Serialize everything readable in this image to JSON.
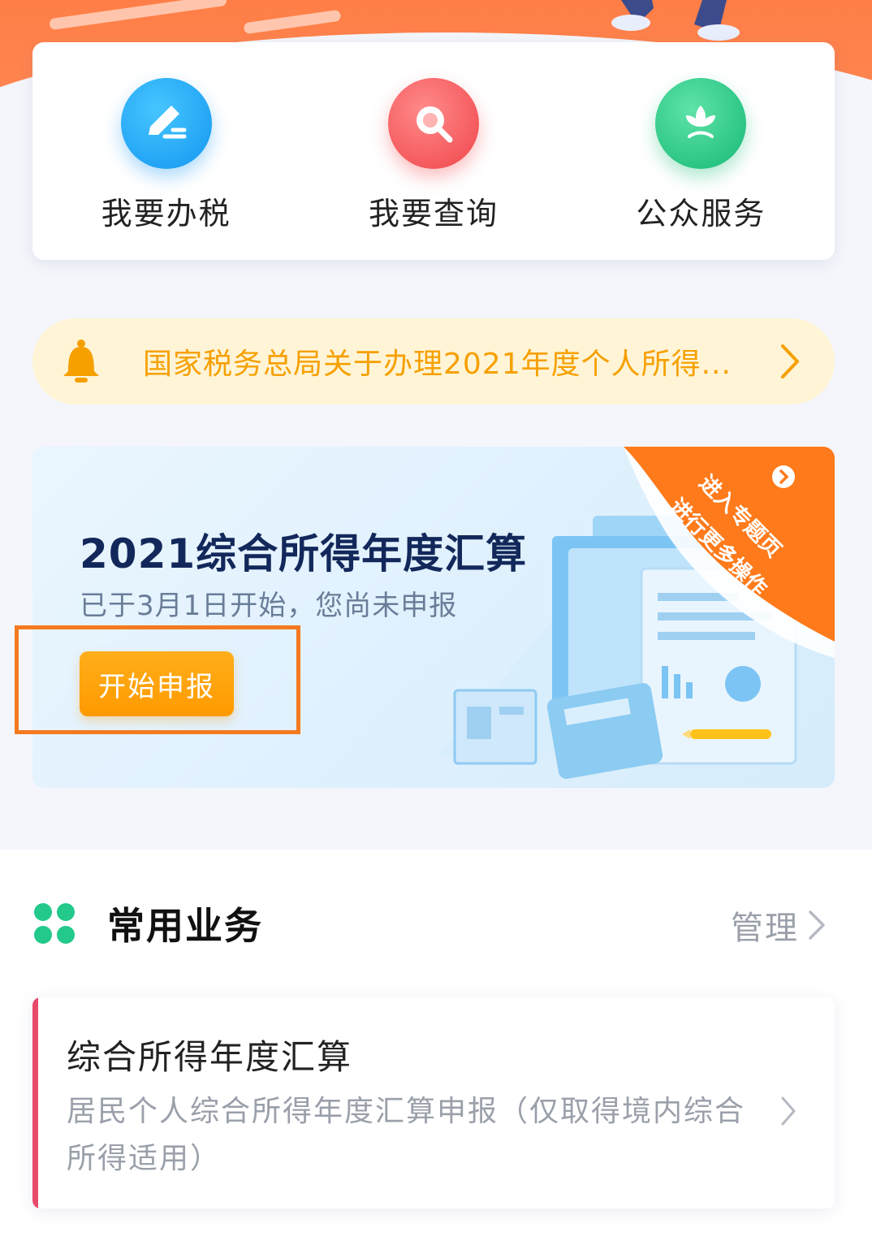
{
  "quick_actions": [
    {
      "label": "我要办税",
      "icon": "edit-icon",
      "color": "#1496f0"
    },
    {
      "label": "我要查询",
      "icon": "search-icon",
      "color": "#f0454a"
    },
    {
      "label": "公众服务",
      "icon": "flower-icon",
      "color": "#16b975"
    }
  ],
  "notice": {
    "text": "国家税务总局关于办理2021年度个人所得...",
    "icon": "bell-icon",
    "color": "#f6a000"
  },
  "banner": {
    "title": "2021综合所得年度汇算",
    "subtitle": "已于3月1日开始，您尚未申报",
    "button_label": "开始申报",
    "corner_line1": "进入专题页",
    "corner_line2": "进行更多操作"
  },
  "common_services": {
    "title": "常用业务",
    "manage_label": "管理",
    "items": [
      {
        "title": "综合所得年度汇算",
        "description": "居民个人综合所得年度汇算申报（仅取得境内综合所得适用）"
      }
    ]
  },
  "colors": {
    "accent_orange": "#ff9a00",
    "banner_title": "#13285a",
    "highlight_border": "#f47a20"
  }
}
